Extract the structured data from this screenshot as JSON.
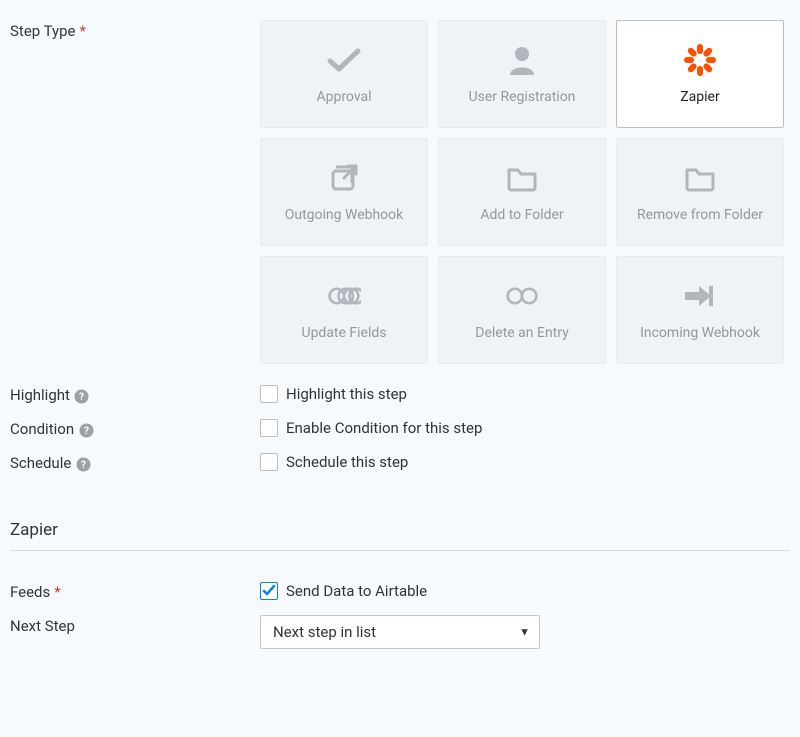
{
  "stepType": {
    "label": "Step Type",
    "required": "*",
    "options": [
      {
        "label": "Approval",
        "icon": "check",
        "selected": false
      },
      {
        "label": "User Registration",
        "icon": "user",
        "selected": false
      },
      {
        "label": "Zapier",
        "icon": "zapier",
        "selected": true
      },
      {
        "label": "Outgoing Webhook",
        "icon": "external",
        "selected": false
      },
      {
        "label": "Add to Folder",
        "icon": "folder",
        "selected": false
      },
      {
        "label": "Remove from Folder",
        "icon": "folder",
        "selected": false
      },
      {
        "label": "Update Fields",
        "icon": "link",
        "selected": false
      },
      {
        "label": "Delete an Entry",
        "icon": "link",
        "selected": false
      },
      {
        "label": "Incoming Webhook",
        "icon": "arrow-in",
        "selected": false
      }
    ]
  },
  "highlight": {
    "label": "Highlight",
    "checkbox_label": "Highlight this step",
    "checked": false
  },
  "condition": {
    "label": "Condition",
    "checkbox_label": "Enable Condition for this step",
    "checked": false
  },
  "schedule": {
    "label": "Schedule",
    "checkbox_label": "Schedule this step",
    "checked": false
  },
  "section": {
    "title": "Zapier"
  },
  "feeds": {
    "label": "Feeds",
    "required": "*",
    "checkbox_label": "Send Data to Airtable",
    "checked": true
  },
  "nextStep": {
    "label": "Next Step",
    "selected": "Next step in list"
  }
}
